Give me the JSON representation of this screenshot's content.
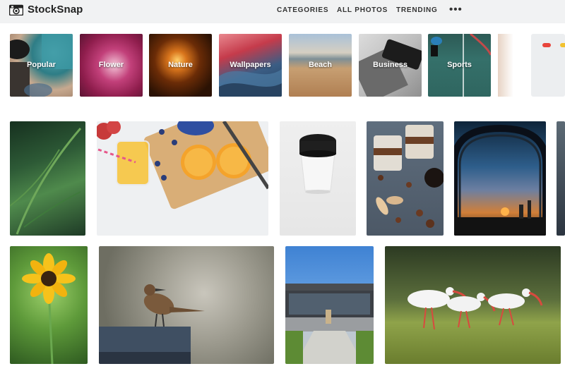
{
  "brand": {
    "name": "StockSnap",
    "icon": "camera-icon"
  },
  "nav": {
    "categories": "CATEGORIES",
    "all_photos": "ALL PHOTOS",
    "trending": "TRENDING",
    "more": "•••"
  },
  "categories": [
    {
      "label": "Popular"
    },
    {
      "label": "Flower"
    },
    {
      "label": "Nature"
    },
    {
      "label": "Wallpapers"
    },
    {
      "label": "Beach"
    },
    {
      "label": "Business"
    },
    {
      "label": "Sports"
    }
  ],
  "colors": {
    "header_bg": "#f1f2f3",
    "label_text": "#ffffff",
    "carousel_dot_red": "#e8453c",
    "carousel_dot_yellow": "#f2c230"
  },
  "photos_row1": [
    "fern",
    "orange-juice",
    "coffee-cup",
    "coffee-beans-dessert",
    "city-sunset-arch",
    "partial"
  ],
  "photos_row2": [
    "yellow-flower",
    "bird-on-post",
    "building-walkway",
    "white-ibis"
  ]
}
